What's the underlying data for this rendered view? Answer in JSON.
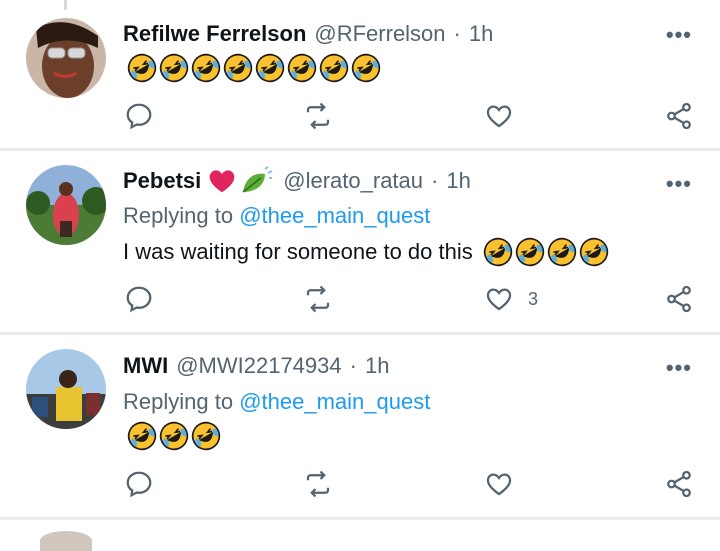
{
  "tweets": [
    {
      "name": "Refilwe Ferrelson",
      "handle": "@RFerrelson",
      "separator": "·",
      "time": "1h",
      "more_label": "•••",
      "replying_to_prefix": "",
      "replying_to_mention": "",
      "text": "",
      "emojis": [
        "rofl",
        "rofl",
        "rofl",
        "rofl",
        "rofl",
        "rofl",
        "rofl",
        "rofl"
      ],
      "like_count": ""
    },
    {
      "name": "Pebetsi",
      "name_emojis": [
        "red-heart",
        "leaf-fluttering-in-wind"
      ],
      "handle": "@lerato_ratau",
      "separator": "·",
      "time": "1h",
      "more_label": "•••",
      "replying_to_prefix": "Replying to ",
      "replying_to_mention": "@thee_main_quest",
      "text": "I was waiting for someone to do this ",
      "emojis": [
        "rofl",
        "rofl",
        "rofl",
        "rofl"
      ],
      "like_count": "3"
    },
    {
      "name": "MWI",
      "handle": "@MWI22174934",
      "separator": "·",
      "time": "1h",
      "more_label": "•••",
      "replying_to_prefix": "Replying to ",
      "replying_to_mention": "@thee_main_quest",
      "text": "",
      "emojis": [
        "rofl",
        "rofl",
        "rofl"
      ],
      "like_count": ""
    }
  ],
  "icons": {
    "reply": "reply-icon",
    "retweet": "retweet-icon",
    "like": "heart-icon",
    "share": "share-icon",
    "more": "more-icon"
  },
  "colors": {
    "text": "#0f1419",
    "secondary": "#536471",
    "link": "#1d9bf0",
    "divider": "#e9edef",
    "emoji_face": "#fbc02d",
    "heart": "#e0245e"
  }
}
